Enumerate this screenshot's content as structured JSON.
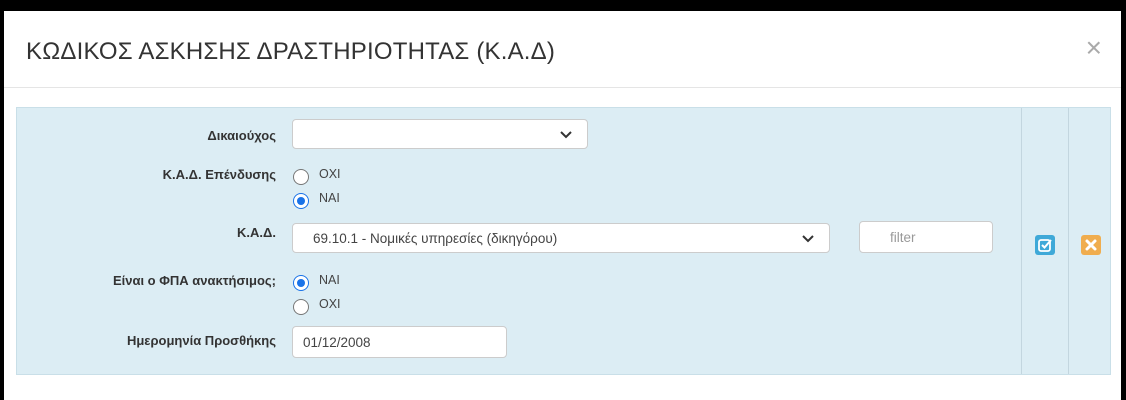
{
  "dialog": {
    "title": "ΚΩΔΙΚΟΣ ΑΣΚΗΣΗΣ ΔΡΑΣΤΗΡΙΟΤΗΤΑΣ (Κ.Α.Δ)",
    "close_symbol": "×"
  },
  "form": {
    "beneficiary": {
      "label": "Δικαιούχος",
      "value": ""
    },
    "kad_investment": {
      "label": "Κ.Α.Δ. Επένδυσης",
      "options": [
        {
          "label": "ΟΧΙ",
          "checked": false
        },
        {
          "label": "ΝΑΙ",
          "checked": true
        }
      ]
    },
    "kad": {
      "label": "Κ.Α.Δ.",
      "value": "69.10.1 - Νομικές υπηρεσίες (δικηγόρου)",
      "filter_placeholder": "filter"
    },
    "vat_recoverable": {
      "label": "Είναι ο ΦΠΑ ανακτήσιμος;",
      "options": [
        {
          "label": "ΝΑΙ",
          "checked": true
        },
        {
          "label": "ΟΧΙ",
          "checked": false
        }
      ]
    },
    "date_added": {
      "label": "Ημερομηνία Προσθήκης",
      "value": "01/12/2008"
    }
  },
  "actions": {
    "save_icon": "edit-check-icon",
    "delete_icon": "close-icon",
    "save_color": "#3fa9d8",
    "delete_color": "#f0ad4e"
  }
}
